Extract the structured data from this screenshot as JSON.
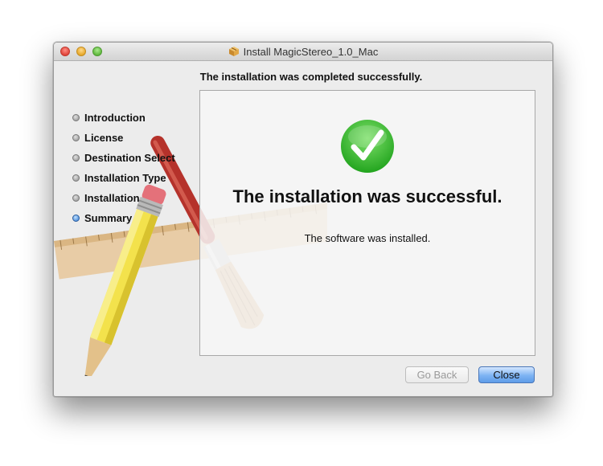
{
  "window": {
    "title": "Install MagicStereo_1.0_Mac"
  },
  "header": {
    "message": "The installation was completed successfully."
  },
  "sidebar": {
    "steps": [
      {
        "label": "Introduction",
        "active": false
      },
      {
        "label": "License",
        "active": false
      },
      {
        "label": "Destination Select",
        "active": false
      },
      {
        "label": "Installation Type",
        "active": false
      },
      {
        "label": "Installation",
        "active": false
      },
      {
        "label": "Summary",
        "active": true
      }
    ]
  },
  "content": {
    "title": "The installation was successful.",
    "message": "The software was installed."
  },
  "buttons": {
    "back": "Go Back",
    "close": "Close"
  },
  "colors": {
    "check_green": "#35b52d",
    "default_button": "#5e9ce8",
    "active_step": "#2f77d0"
  },
  "icons": {
    "titlebar": "package-icon",
    "status": "checkmark-icon"
  }
}
